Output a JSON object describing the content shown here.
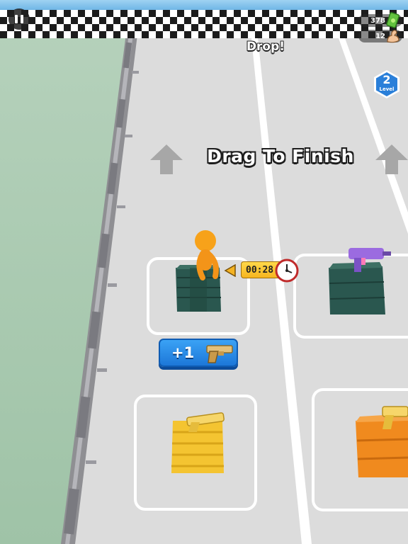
{
  "hud": {
    "pause_label": "",
    "cash_count": "378",
    "power_count": "12"
  },
  "status": {
    "drop_text": "Drop!"
  },
  "level": {
    "number": "2",
    "word": "Level"
  },
  "instruction": {
    "headline": "Drag To Finish"
  },
  "timer": {
    "value": "00:28"
  },
  "bonus": {
    "label": "+1"
  },
  "colors": {
    "accent_blue": "#1d77d8",
    "timer_yellow": "#f6b51f",
    "character_orange": "#f7a21a",
    "crate_green": "#2c5a52",
    "crate_gold": "#f4c431",
    "crate_orange": "#f08a1e",
    "level_badge": "#2a7fd9"
  },
  "icons": {
    "pause": "pause-icon",
    "cash": "cash-icon",
    "power": "flexed-arm-icon",
    "clock": "clock-icon",
    "pistol": "pistol-icon",
    "uzi": "uzi-icon"
  }
}
